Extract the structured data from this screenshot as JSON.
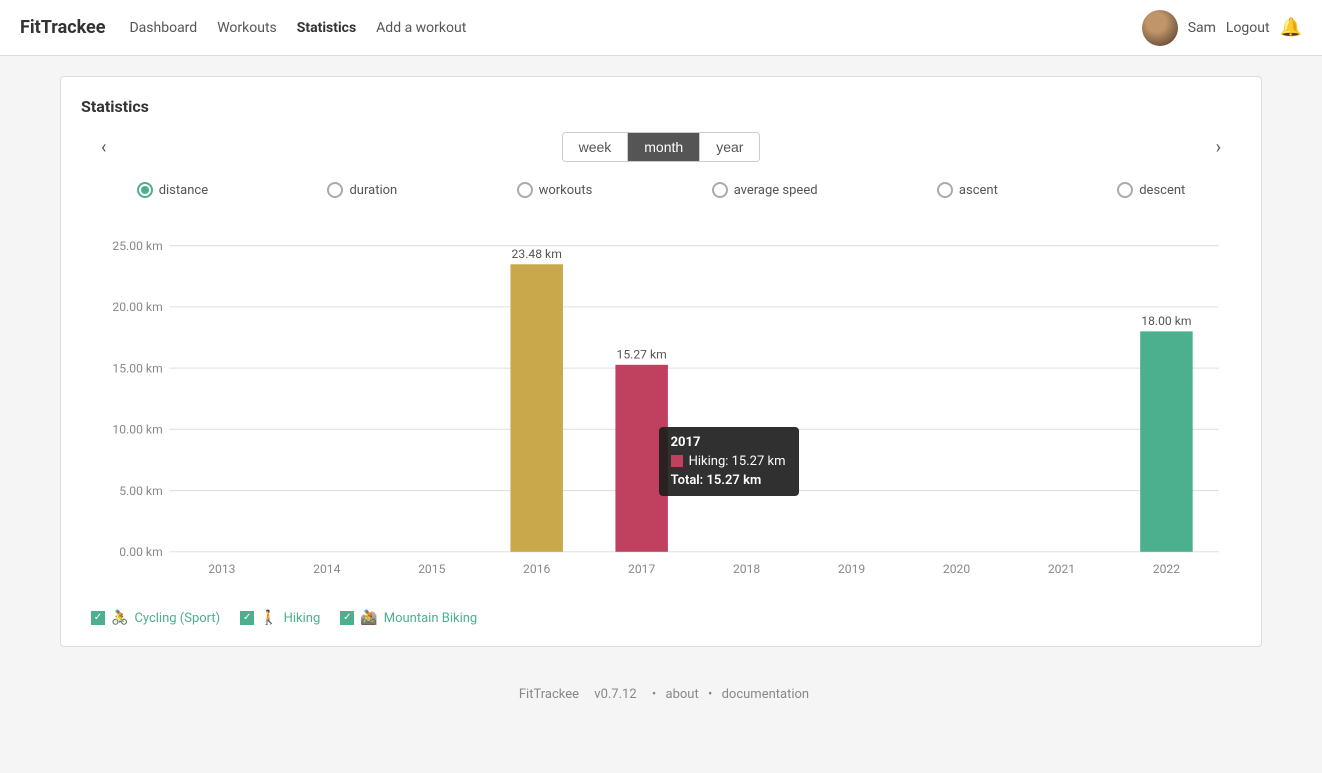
{
  "brand": "FitTrackee",
  "nav": {
    "links": [
      {
        "label": "Dashboard",
        "href": "#",
        "active": false
      },
      {
        "label": "Workouts",
        "href": "#",
        "active": false
      },
      {
        "label": "Statistics",
        "href": "#",
        "active": true
      },
      {
        "label": "Add a workout",
        "href": "#",
        "active": false
      }
    ],
    "user": "Sam",
    "logout": "Logout"
  },
  "page": {
    "title": "Statistics"
  },
  "time_buttons": [
    {
      "label": "week",
      "active": false
    },
    {
      "label": "month",
      "active": true
    },
    {
      "label": "year",
      "active": false
    }
  ],
  "metrics": [
    {
      "label": "distance",
      "selected": true
    },
    {
      "label": "duration",
      "selected": false
    },
    {
      "label": "workouts",
      "selected": false
    },
    {
      "label": "average speed",
      "selected": false
    },
    {
      "label": "ascent",
      "selected": false
    },
    {
      "label": "descent",
      "selected": false
    }
  ],
  "chart": {
    "y_labels": [
      "25.00 km",
      "20.00 km",
      "15.00 km",
      "10.00 km",
      "5.00 km",
      "0.00 km"
    ],
    "x_labels": [
      "2013",
      "2014",
      "2015",
      "2016",
      "2017",
      "2018",
      "2019",
      "2020",
      "2021",
      "2022"
    ],
    "bars": [
      {
        "year": "2013",
        "value": 0,
        "color": "#c8a84b",
        "label": ""
      },
      {
        "year": "2014",
        "value": 0,
        "color": "#c8a84b",
        "label": ""
      },
      {
        "year": "2015",
        "value": 0,
        "color": "#c8a84b",
        "label": ""
      },
      {
        "year": "2016",
        "value": 23.48,
        "color": "#c8a84b",
        "label": "23.48 km"
      },
      {
        "year": "2017",
        "value": 15.27,
        "color": "#c04060",
        "label": "15.27 km"
      },
      {
        "year": "2018",
        "value": 0,
        "color": "#c8a84b",
        "label": ""
      },
      {
        "year": "2019",
        "value": 0,
        "color": "#c8a84b",
        "label": ""
      },
      {
        "year": "2020",
        "value": 0,
        "color": "#c8a84b",
        "label": ""
      },
      {
        "year": "2021",
        "value": 0,
        "color": "#c8a84b",
        "label": ""
      },
      {
        "year": "2022",
        "value": 18.0,
        "color": "#4caf8e",
        "label": "18.00 km"
      }
    ],
    "max_value": 25.0,
    "tooltip": {
      "year": "2017",
      "rows": [
        {
          "sport": "Hiking",
          "value": "15.27 km",
          "color": "#c04060"
        }
      ],
      "total": "Total: 15.27 km"
    }
  },
  "legend": [
    {
      "label": "Cycling (Sport)",
      "icon": "🚴",
      "color": "#c8a84b"
    },
    {
      "label": "Hiking",
      "icon": "🚶",
      "color": "#c04060"
    },
    {
      "label": "Mountain Biking",
      "icon": "🚵",
      "color": "#c8a84b"
    }
  ],
  "footer": {
    "brand": "FitTrackee",
    "version": "v0.7.12",
    "about": "about",
    "documentation": "documentation"
  }
}
